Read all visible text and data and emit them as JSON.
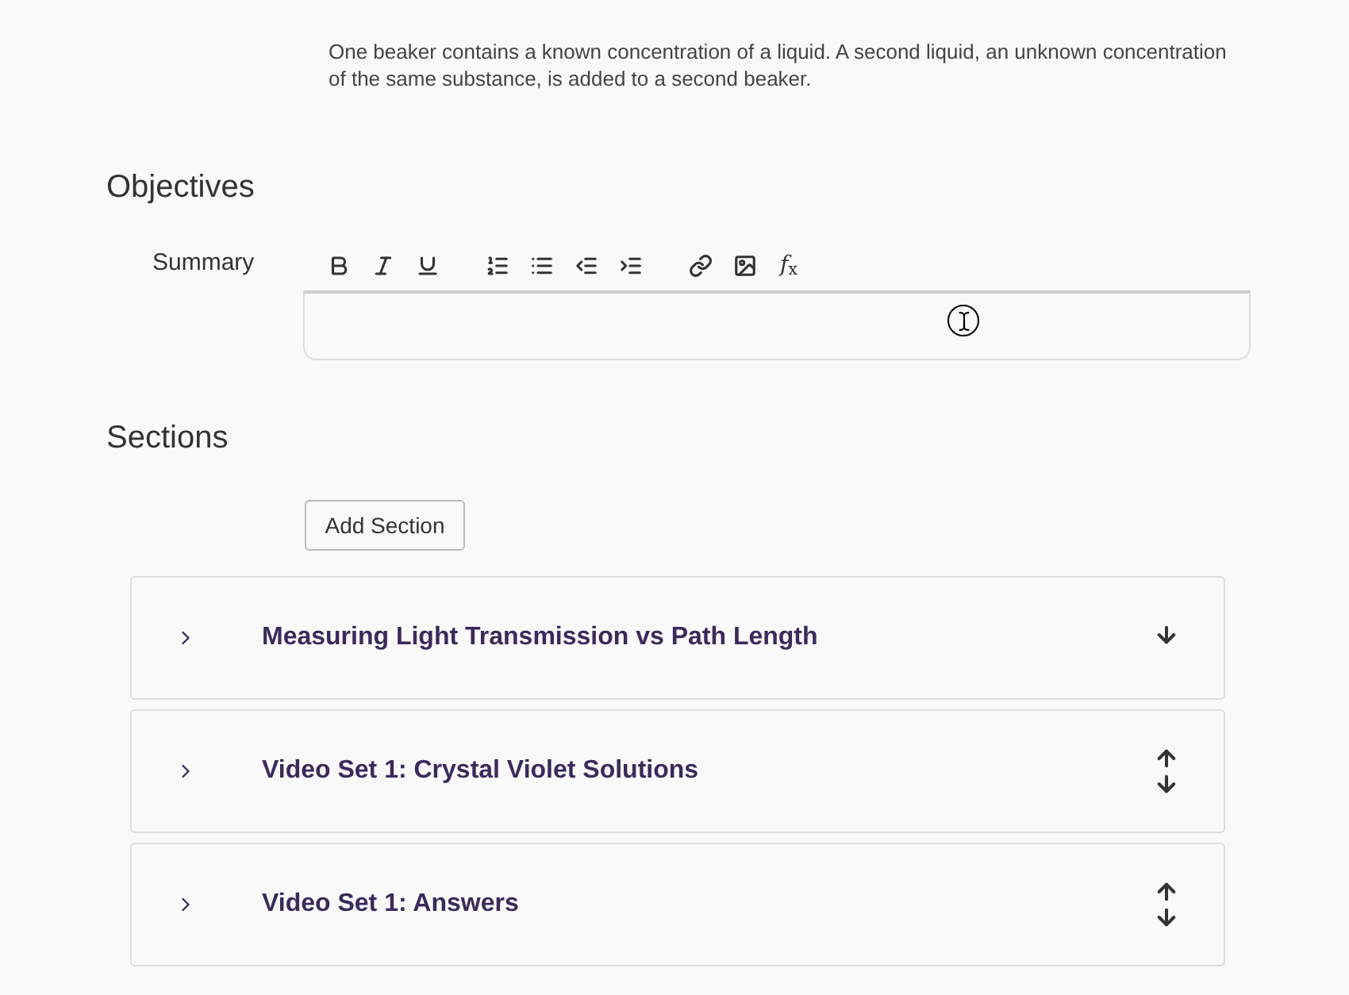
{
  "description": "One beaker contains a known concentration of a liquid. A second liquid, an unknown concentration of the same substance, is added to a second beaker.",
  "objectives": {
    "heading": "Objectives",
    "summary_label": "Summary",
    "formula_button": "*f*$_{x}$"
  },
  "sections": {
    "heading": "Sections",
    "add_button": "Add Section",
    "items": [
      {
        "title": "Measuring Light Transmission vs Path Length",
        "expanded": false,
        "kind": "down"
      },
      {
        "title": "Video Set 1: Crystal Violet Solutions",
        "expanded": false,
        "kind": "updown"
      },
      {
        "title": "Video Set 1: Answers",
        "expanded": false,
        "kind": "updown"
      }
    ]
  }
}
